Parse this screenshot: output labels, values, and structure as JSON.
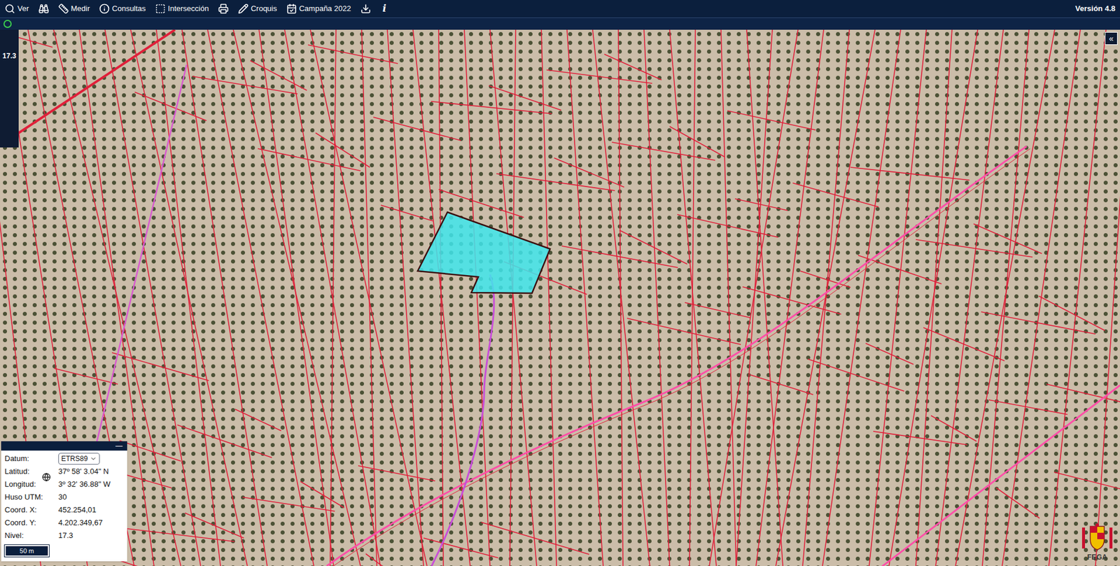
{
  "toolbar": {
    "items": [
      {
        "label": "Ver",
        "kind": "search"
      },
      {
        "kind": "binoculars"
      },
      {
        "label": "Medir",
        "kind": "measure"
      },
      {
        "label": "Consultas",
        "kind": "info"
      },
      {
        "label": "Intersección",
        "kind": "intersect"
      },
      {
        "kind": "print"
      },
      {
        "label": "Croquis",
        "kind": "pencil"
      },
      {
        "label": "Campaña 2022",
        "kind": "calendar"
      },
      {
        "kind": "download"
      },
      {
        "label": "i",
        "kind": "text"
      }
    ],
    "version": "Versión 4.8"
  },
  "status_bar": {
    "connected": true
  },
  "zoom": {
    "level": "17.3"
  },
  "panel_toggle": "«",
  "coords_panel": {
    "minimize": "—",
    "rows": [
      {
        "label": "Datum:",
        "value": "ETRS89",
        "kind": "select"
      },
      {
        "label": "Latitud:",
        "value": "37º 58' 3.04\" N",
        "kind": "globe"
      },
      {
        "label": "Longitud:",
        "value": "3º 32' 36.88\" W",
        "kind": "text"
      },
      {
        "label": "Huso UTM:",
        "value": "30",
        "kind": "text"
      },
      {
        "label": "Coord. X:",
        "value": "452.254,01",
        "kind": "text"
      },
      {
        "label": "Coord. Y:",
        "value": "4.202.349,67",
        "kind": "text"
      },
      {
        "label": "Nivel:",
        "value": "17.3",
        "kind": "text"
      }
    ],
    "scale": "50 m"
  },
  "map": {
    "parcel_selected": true
  },
  "logo": {
    "text": "FEGA"
  }
}
